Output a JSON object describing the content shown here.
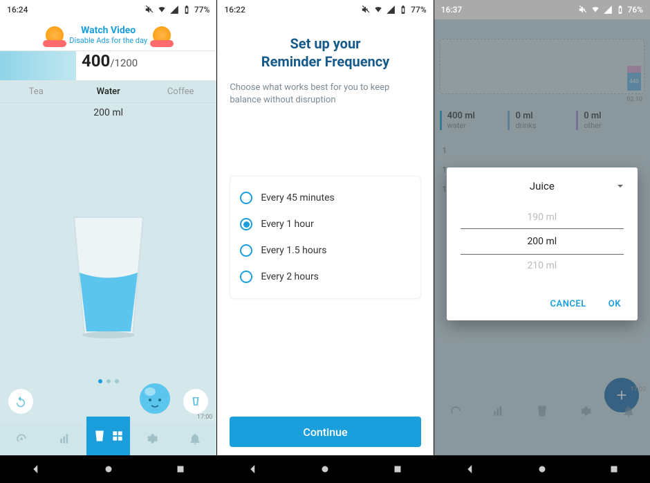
{
  "screen1": {
    "status": {
      "time": "16:24",
      "battery": "77%"
    },
    "ad": {
      "title": "Watch Video",
      "sub": "Disable Ads for the day"
    },
    "counter": {
      "value": "400",
      "sep": "/",
      "max": "1200"
    },
    "tabs": [
      "Tea",
      "Water",
      "Coffee"
    ],
    "amount": "200 ml",
    "time_tag": "17:00"
  },
  "screen2": {
    "status": {
      "time": "16:22",
      "battery": "77%"
    },
    "title_l1": "Set up your",
    "title_l2": "Reminder Frequency",
    "subtitle": "Choose what works best for you to keep balance without disruption",
    "options": [
      {
        "label": "Every 45 minutes",
        "selected": false
      },
      {
        "label": "Every 1 hour",
        "selected": true
      },
      {
        "label": "Every 1.5 hours",
        "selected": false
      },
      {
        "label": "Every 2 hours",
        "selected": false
      }
    ],
    "continue": "Continue"
  },
  "screen3": {
    "status": {
      "time": "16:37",
      "battery": "76%"
    },
    "graph": {
      "bar_label": "440",
      "time": "02.10"
    },
    "stats": [
      {
        "value": "400 ml",
        "label": "water"
      },
      {
        "value": "0 ml",
        "label": "drinks"
      },
      {
        "value": "0 ml",
        "label": "other"
      }
    ],
    "log_times": [
      "1",
      "1",
      "1"
    ],
    "dialog": {
      "drink": "Juice",
      "values": [
        "190 ml",
        "200 ml",
        "210 ml"
      ],
      "cancel": "CANCEL",
      "ok": "OK"
    },
    "time_tag": "17:00"
  }
}
